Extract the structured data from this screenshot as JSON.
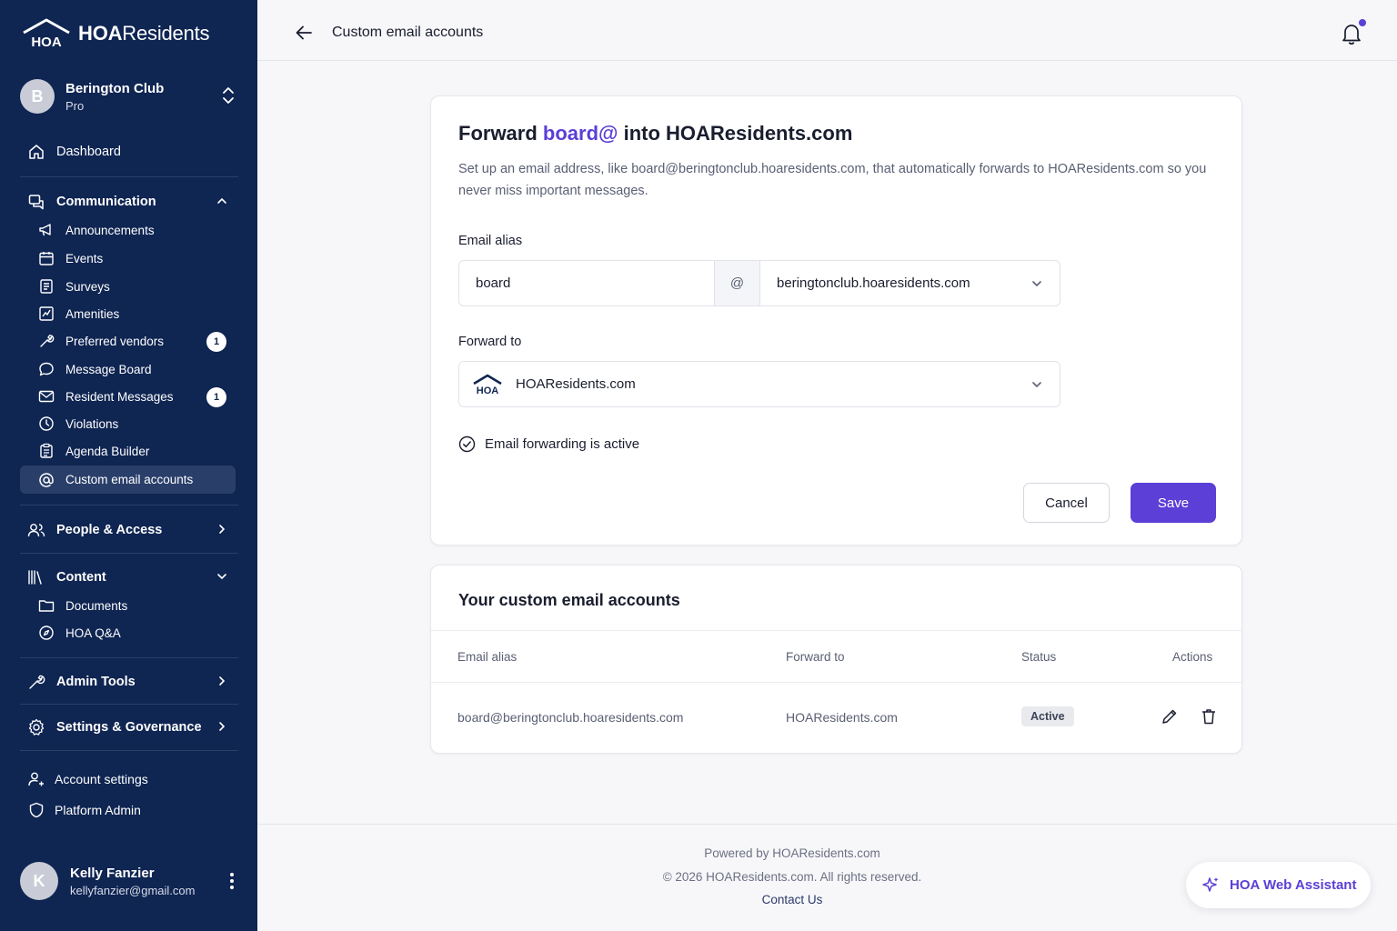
{
  "colors": {
    "sidebar_bg": "#0f2552",
    "accent": "#5b3fd6",
    "page_bg": "#f7f7f9"
  },
  "brand": {
    "logo_mark": "HOA",
    "prefix": "HOA",
    "suffix": "Residents"
  },
  "org": {
    "initial": "B",
    "name": "Berington Club",
    "plan": "Pro"
  },
  "sidebar": {
    "dashboard": "Dashboard",
    "communication": {
      "label": "Communication",
      "items": [
        {
          "label": "Announcements",
          "icon": "megaphone-icon"
        },
        {
          "label": "Events",
          "icon": "calendar-icon"
        },
        {
          "label": "Surveys",
          "icon": "clipboard-list-icon"
        },
        {
          "label": "Amenities",
          "icon": "chart-box-icon"
        },
        {
          "label": "Preferred vendors",
          "icon": "wrench-icon",
          "badge": "1"
        },
        {
          "label": "Message Board",
          "icon": "chat-bubble-icon"
        },
        {
          "label": "Resident Messages",
          "icon": "mail-icon",
          "badge": "1"
        },
        {
          "label": "Violations",
          "icon": "clock-icon"
        },
        {
          "label": "Agenda Builder",
          "icon": "clipboard-icon"
        },
        {
          "label": "Custom email accounts",
          "icon": "at-sign-icon",
          "active": true
        }
      ]
    },
    "people_access": "People & Access",
    "content": {
      "label": "Content",
      "items": [
        {
          "label": "Documents",
          "icon": "folder-icon"
        },
        {
          "label": "HOA Q&A",
          "icon": "compass-icon"
        }
      ]
    },
    "admin_tools": "Admin Tools",
    "settings_governance": "Settings & Governance",
    "account_settings": "Account settings",
    "platform_admin": "Platform Admin"
  },
  "user": {
    "initial": "K",
    "name": "Kelly Fanzier",
    "email": "kellyfanzier@gmail.com"
  },
  "header": {
    "title": "Custom email accounts"
  },
  "form": {
    "title_prefix": "Forward ",
    "title_accent": "board@",
    "title_suffix": " into HOAResidents.com",
    "description": "Set up an email address, like board@beringtonclub.hoaresidents.com, that automatically forwards to HOAResidents.com so you never miss important messages.",
    "alias_label": "Email alias",
    "alias_value": "board",
    "at_symbol": "@",
    "domain_value": "beringtonclub.hoaresidents.com",
    "forward_label": "Forward to",
    "forward_value": "HOAResidents.com",
    "forward_logo": "HOA",
    "status_text": "Email forwarding is active",
    "cancel_label": "Cancel",
    "save_label": "Save"
  },
  "accounts": {
    "title": "Your custom email accounts",
    "columns": [
      "Email alias",
      "Forward to",
      "Status",
      "Actions"
    ],
    "rows": [
      {
        "alias": "board@beringtonclub.hoaresidents.com",
        "forward": "HOAResidents.com",
        "status": "Active"
      }
    ]
  },
  "footer": {
    "powered": "Powered by HOAResidents.com",
    "copyright": "© 2026 HOAResidents.com. All rights reserved.",
    "contact": "Contact Us"
  },
  "assistant": {
    "label": "HOA Web Assistant"
  }
}
